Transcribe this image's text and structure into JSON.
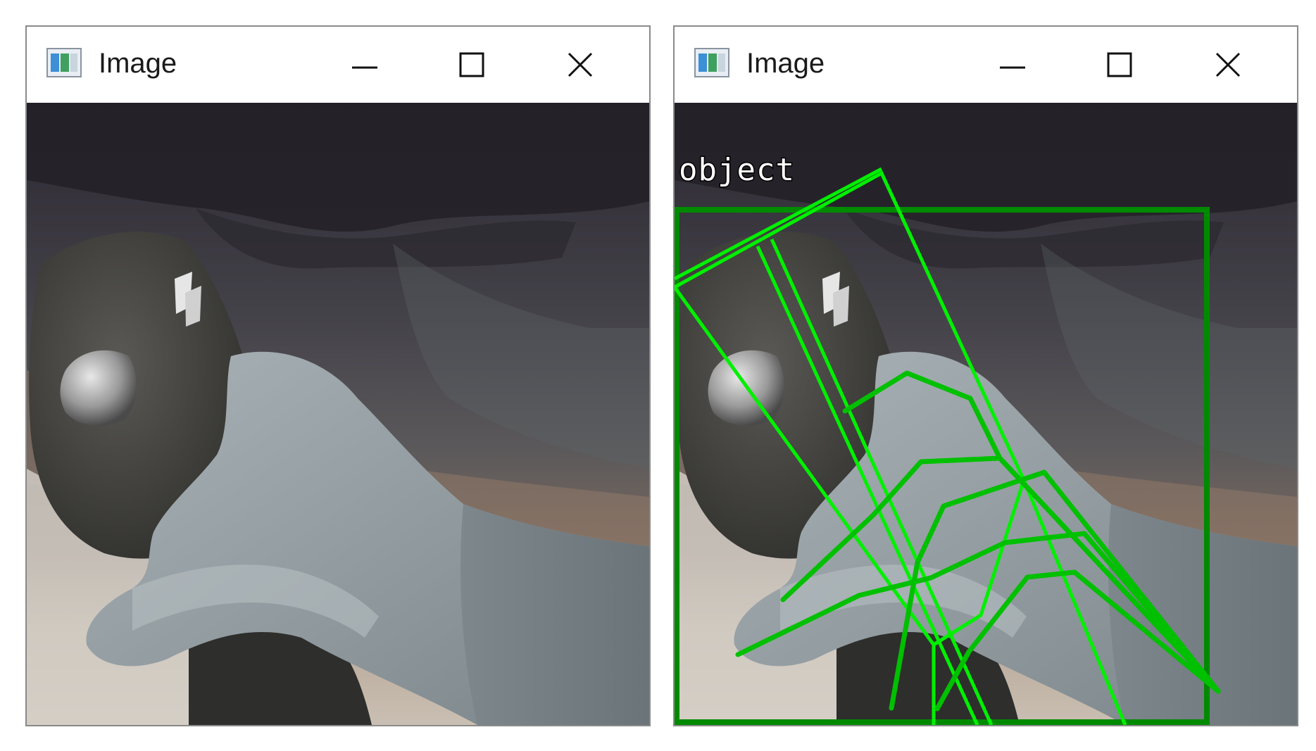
{
  "windows": [
    {
      "title": "Image",
      "controls": {
        "minimize": "minimize",
        "maximize": "maximize",
        "close": "close"
      }
    },
    {
      "title": "Image",
      "controls": {
        "minimize": "minimize",
        "maximize": "maximize",
        "close": "close"
      },
      "detection": {
        "label": "object",
        "box_color": "#008a00",
        "skeleton_color": "#00c000",
        "object_box_color": "#00ff00"
      }
    }
  ],
  "icons": {
    "app": "image-window-icon",
    "minimize": "minimize-icon",
    "maximize": "maximize-icon",
    "close": "close-icon"
  }
}
